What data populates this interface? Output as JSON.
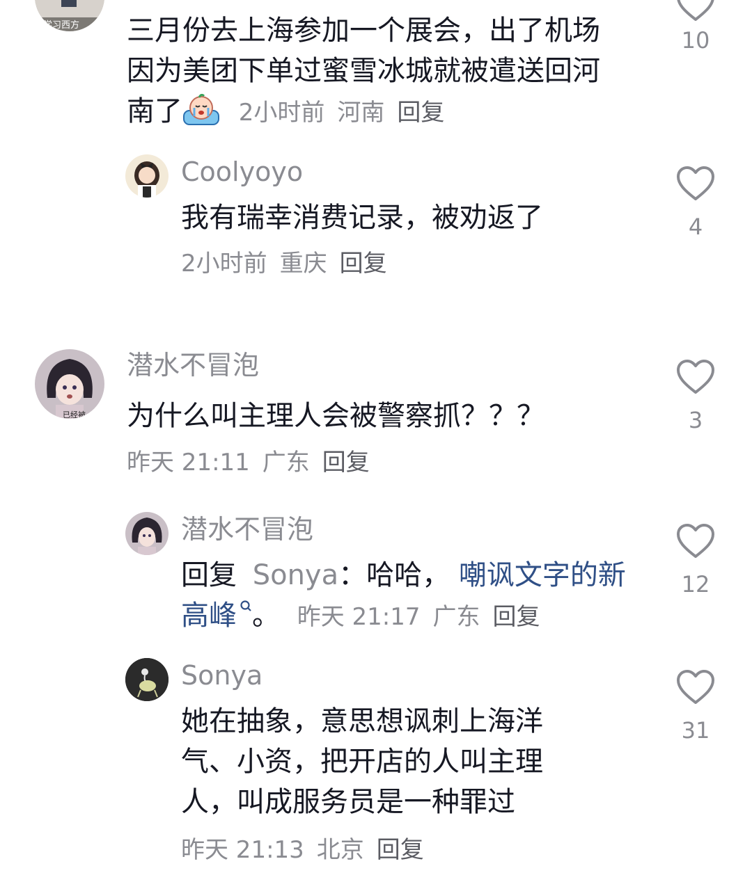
{
  "comments": [
    {
      "avatar_caption": "学习西方",
      "text": "三月份去上海参加一个展会，出了机场因为美团下单过蜜雪冰城就被遣送回河南了",
      "emoji": "crying-emoji",
      "time": "2小时前",
      "location": "河南",
      "reply_label": "回复",
      "likes": "10"
    },
    {
      "user": "Coolyoyo",
      "text": "我有瑞幸消费记录，被劝返了",
      "time": "2小时前",
      "location": "重庆",
      "reply_label": "回复",
      "likes": "4"
    },
    {
      "user": "潜水不冒泡",
      "avatar_caption": "已经被",
      "text": "为什么叫主理人会被警察抓？？？",
      "time": "昨天 21:11",
      "location": "广东",
      "reply_label": "回复",
      "likes": "3"
    },
    {
      "user": "潜水不冒泡",
      "reply_prefix": "回复",
      "reply_to": "Sonya",
      "reply_text": "：哈哈，",
      "link_text": "嘲讽文字的新高峰",
      "suffix": "。",
      "time": "昨天 21:17",
      "location": "广东",
      "reply_label": "回复",
      "likes": "12"
    },
    {
      "user": "Sonya",
      "text": "她在抽象，意思想讽刺上海洋气、小资，把开店的人叫主理人，叫成服务员是一种罪过",
      "time": "昨天 21:13",
      "location": "北京",
      "reply_label": "回复",
      "likes": "31"
    }
  ],
  "colors": {
    "text": "#161823",
    "secondary": "#8a8b91",
    "link": "#2f4f86",
    "heart_outline": "#8a8b91"
  },
  "icons": [
    "heart-outline-icon",
    "search-icon",
    "crying-emoji"
  ]
}
